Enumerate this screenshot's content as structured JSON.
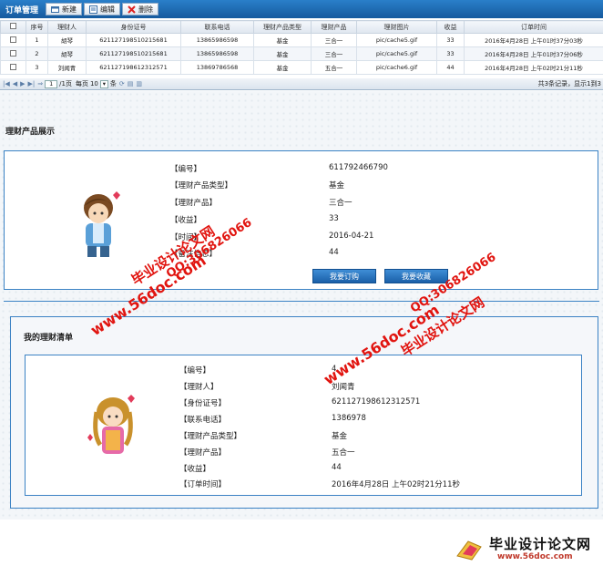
{
  "toolbar": {
    "title": "订单管理",
    "new_label": "新建",
    "edit_label": "编辑",
    "delete_label": "删除"
  },
  "grid": {
    "columns": [
      "",
      "序号",
      "理财人",
      "身份证号",
      "联系电话",
      "理财产品类型",
      "理财产品",
      "理财图片",
      "收益",
      "订单时间"
    ],
    "rows": [
      [
        "1",
        "胡琴",
        "621127198510215681",
        "13865986598",
        "基金",
        "三合一",
        "pic/cache5.gif",
        "33",
        "2016年4月28日 上午01时37分03秒"
      ],
      [
        "2",
        "胡琴",
        "621127198510215681",
        "13865986598",
        "基金",
        "三合一",
        "pic/cache5.gif",
        "33",
        "2016年4月28日 上午01时37分06秒"
      ],
      [
        "3",
        "刘闻青",
        "621127198612312571",
        "13869786568",
        "基金",
        "五合一",
        "pic/cache6.gif",
        "44",
        "2016年4月28日 上午02时21分11秒"
      ]
    ]
  },
  "pager": {
    "page_value": "1",
    "page_total": "/1页",
    "per_page_label": "每页",
    "per_page_value": "10",
    "per_page_unit": "条",
    "summary": "共3条记录，显示1到3"
  },
  "product_section": {
    "title": "理财产品展示",
    "fields": [
      {
        "label": "【编号】",
        "value": "611792466790"
      },
      {
        "label": "【理财产品类型】",
        "value": "基金"
      },
      {
        "label": "【理财产品】",
        "value": "三合一"
      },
      {
        "label": "【收益】",
        "value": "33"
      },
      {
        "label": "【时间】",
        "value": "2016-04-21"
      },
      {
        "label": "【备注信息】",
        "value": "44"
      }
    ],
    "buy_button": "我要订购",
    "back_button": "我要收藏"
  },
  "my_list_section": {
    "title": "我的理财清单",
    "fields": [
      {
        "label": "【编号】",
        "value": "4"
      },
      {
        "label": "【理财人】",
        "value": "刘闻青"
      },
      {
        "label": "【身份证号】",
        "value": "621127198612312571"
      },
      {
        "label": "【联系电话】",
        "value": "1386978"
      },
      {
        "label": "【理财产品类型】",
        "value": "基金"
      },
      {
        "label": "【理财产品】",
        "value": "五合一"
      },
      {
        "label": "【收益】",
        "value": "44"
      },
      {
        "label": "【订单时间】",
        "value": "2016年4月28日 上午02时21分11秒"
      }
    ]
  },
  "watermarks": {
    "site": "www.56doc.com",
    "qq": "QQ:306826066",
    "brand": "毕业设计论文网"
  },
  "footer": {
    "title": "毕业设计论文网",
    "url": "www.56doc.com"
  },
  "colors": {
    "accent": "#1a5fa8",
    "border": "#3b82c4",
    "watermark": "#e1140f"
  }
}
